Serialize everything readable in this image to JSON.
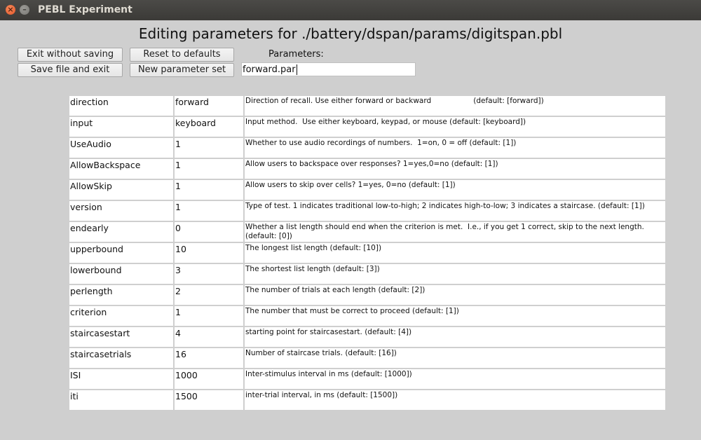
{
  "window": {
    "title": "PEBL Experiment",
    "close_glyph": "×",
    "minimize_glyph": "–"
  },
  "heading": "Editing parameters for ./battery/dspan/params/digitspan.pbl",
  "buttons": {
    "exit": "Exit without saving",
    "reset": "Reset to defaults",
    "save": "Save file and exit",
    "new": "New parameter set"
  },
  "parameters": {
    "label": "Parameters:",
    "value": "forward.par"
  },
  "rows": [
    {
      "name": "direction",
      "value": "forward",
      "desc": "Direction of recall. Use either forward or backward                  (default: [forward])"
    },
    {
      "name": "input",
      "value": "keyboard",
      "desc": "Input method.  Use either keyboard, keypad, or mouse (default: [keyboard])"
    },
    {
      "name": "UseAudio",
      "value": "1",
      "desc": "Whether to use audio recordings of numbers.  1=on, 0 = off (default: [1])"
    },
    {
      "name": "AllowBackspace",
      "value": "1",
      "desc": "Allow users to backspace over responses? 1=yes,0=no (default: [1])"
    },
    {
      "name": "AllowSkip",
      "value": "1",
      "desc": "Allow users to skip over cells? 1=yes, 0=no (default: [1])"
    },
    {
      "name": "version",
      "value": "1",
      "desc": "Type of test. 1 indicates traditional low-to-high; 2 indicates high-to-low; 3 indicates a staircase. (default: [1])"
    },
    {
      "name": "endearly",
      "value": "0",
      "desc": "Whether a list length should end when the criterion is met.  I.e., if you get 1 correct, skip to the next length. (default: [0])"
    },
    {
      "name": "upperbound",
      "value": "10",
      "desc": "The longest list length (default: [10])"
    },
    {
      "name": "lowerbound",
      "value": "3",
      "desc": "The shortest list length (default: [3])"
    },
    {
      "name": "perlength",
      "value": "2",
      "desc": "The number of trials at each length (default: [2])"
    },
    {
      "name": "criterion",
      "value": "1",
      "desc": "The number that must be correct to proceed (default: [1])"
    },
    {
      "name": "staircasestart",
      "value": "4",
      "desc": "starting point for staircasestart. (default: [4])"
    },
    {
      "name": "staircasetrials",
      "value": "16",
      "desc": "Number of staircase trials. (default: [16])"
    },
    {
      "name": "ISI",
      "value": "1000",
      "desc": "Inter-stimulus interval in ms (default: [1000])"
    },
    {
      "name": "iti",
      "value": "1500",
      "desc": "inter-trial interval, in ms (default: [1500])"
    }
  ]
}
